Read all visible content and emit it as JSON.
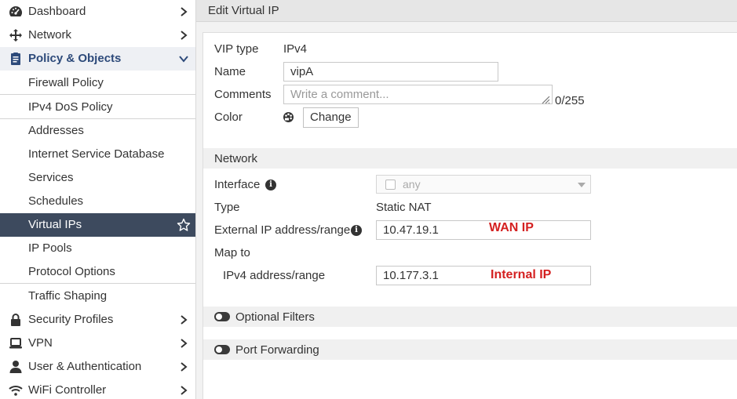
{
  "sidebar": {
    "items": [
      {
        "label": "Dashboard",
        "icon": "dashboard-icon"
      },
      {
        "label": "Network",
        "icon": "network-move-icon"
      },
      {
        "label": "Policy & Objects",
        "icon": "policy-objects-icon"
      },
      {
        "label": "Firewall Policy"
      },
      {
        "label": "IPv4 DoS Policy"
      },
      {
        "label": "Addresses"
      },
      {
        "label": "Internet Service Database"
      },
      {
        "label": "Services"
      },
      {
        "label": "Schedules"
      },
      {
        "label": "Virtual IPs"
      },
      {
        "label": "IP Pools"
      },
      {
        "label": "Protocol Options"
      },
      {
        "label": "Traffic Shaping"
      },
      {
        "label": "Security Profiles",
        "icon": "lock-icon"
      },
      {
        "label": "VPN",
        "icon": "laptop-icon"
      },
      {
        "label": "User & Authentication",
        "icon": "user-icon"
      },
      {
        "label": "WiFi Controller",
        "icon": "wifi-icon"
      }
    ]
  },
  "header": {
    "title": "Edit Virtual IP"
  },
  "form": {
    "vip_type_label": "VIP type",
    "vip_type_value": "IPv4",
    "name_label": "Name",
    "name_value": "vipA",
    "comments_label": "Comments",
    "comments_placeholder": "Write a comment...",
    "comments_counter": "0/255",
    "color_label": "Color",
    "change_button": "Change"
  },
  "network": {
    "section_title": "Network",
    "interface_label": "Interface",
    "interface_value": "any",
    "type_label": "Type",
    "type_value": "Static NAT",
    "external_label": "External IP address/range",
    "external_value": "10.47.19.1",
    "external_annotation": "WAN IP",
    "map_to_label": "Map to",
    "ipv4_label": "IPv4 address/range",
    "ipv4_value": "10.177.3.1",
    "ipv4_annotation": "Internal IP"
  },
  "toggles": {
    "optional_filters": "Optional Filters",
    "port_forwarding": "Port Forwarding"
  },
  "colors": {
    "sidebar_active": "#3d4a5e",
    "section_open_text": "#2d4a7a",
    "annotation": "#d42020"
  }
}
